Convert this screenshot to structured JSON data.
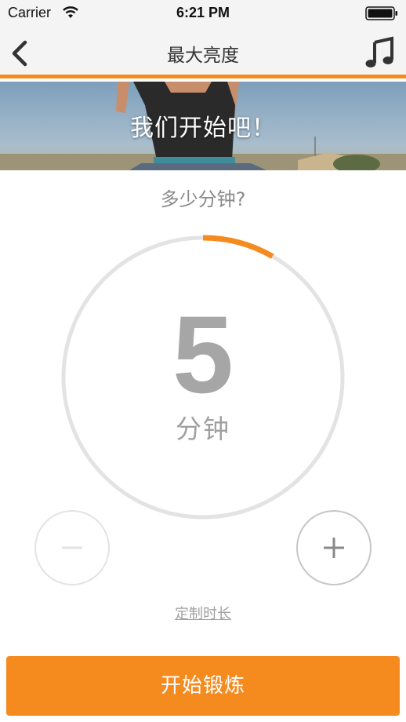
{
  "status_bar": {
    "carrier": "Carrier",
    "time": "6:21 PM",
    "wifi_icon": "wifi-icon",
    "battery_icon": "battery-icon"
  },
  "nav": {
    "title": "最大亮度",
    "back_icon": "chevron-left-icon",
    "music_icon": "music-note-icon"
  },
  "hero": {
    "text": "我们开始吧！"
  },
  "question": "多少分钟?",
  "timer": {
    "value": "5",
    "unit": "分钟",
    "progress_fraction": 0.083
  },
  "controls": {
    "minus_icon": "minus-icon",
    "plus_icon": "plus-icon",
    "custom_duration_label": "定制时长"
  },
  "start_button_label": "开始锻炼",
  "colors": {
    "accent": "#f58a1f",
    "ring_track": "#e3e3e3",
    "muted_text": "#a0a0a0"
  }
}
